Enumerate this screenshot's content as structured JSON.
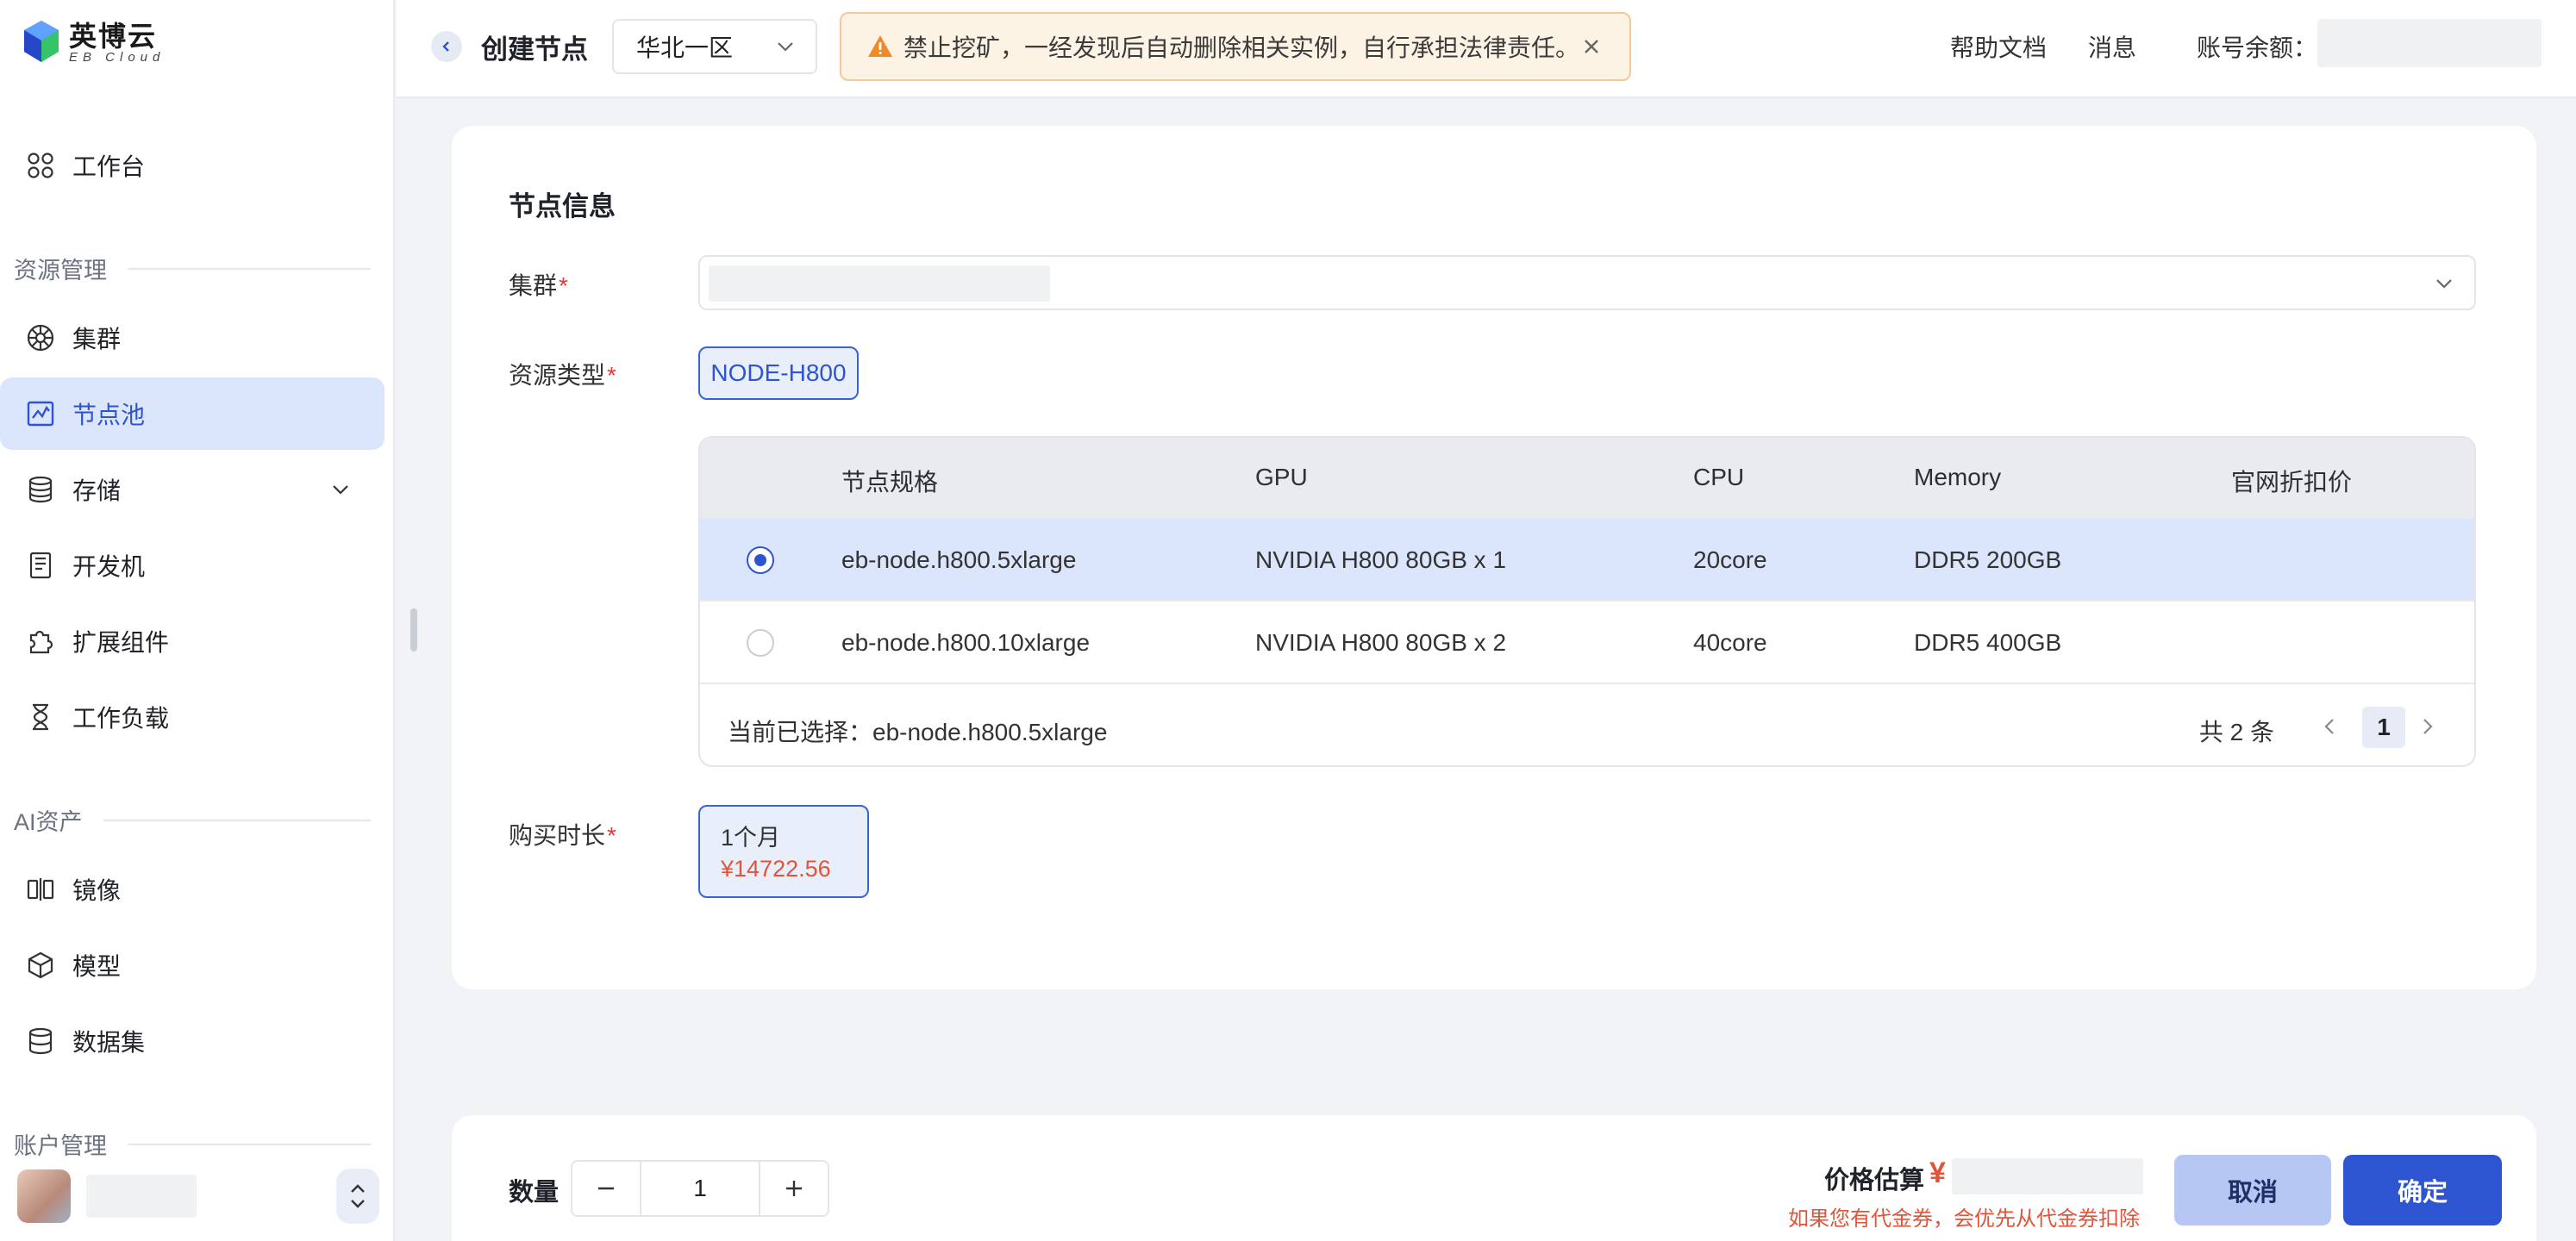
{
  "brand": {
    "name_cn": "英博云",
    "name_en": "EB Cloud"
  },
  "sidebar": {
    "workbench": "工作台",
    "sections": {
      "resource": "资源管理",
      "ai_assets": "AI资产",
      "account": "账户管理"
    },
    "items": [
      {
        "label": "集群",
        "icon": "cluster-icon"
      },
      {
        "label": "节点池",
        "icon": "node-pool-icon",
        "active": true
      },
      {
        "label": "存储",
        "icon": "storage-icon",
        "expandable": true
      },
      {
        "label": "开发机",
        "icon": "dev-machine-icon"
      },
      {
        "label": "扩展组件",
        "icon": "puzzle-icon"
      },
      {
        "label": "工作负载",
        "icon": "hourglass-icon"
      },
      {
        "label": "镜像",
        "icon": "image-icon"
      },
      {
        "label": "模型",
        "icon": "cube-icon"
      },
      {
        "label": "数据集",
        "icon": "database-icon"
      }
    ]
  },
  "header": {
    "title": "创建节点",
    "region": "华北一区",
    "warning": "禁止挖矿，一经发现后自动删除相关实例，自行承担法律责任。",
    "help": "帮助文档",
    "messages": "消息",
    "balance_label": "账号余额："
  },
  "form": {
    "section_title": "节点信息",
    "cluster_label": "集群",
    "resource_type_label": "资源类型",
    "resource_type": "NODE-H800",
    "duration_label": "购买时长",
    "duration": {
      "period": "1个月",
      "price": "¥14722.56"
    }
  },
  "table": {
    "columns": [
      "节点规格",
      "GPU",
      "CPU",
      "Memory",
      "官网折扣价"
    ],
    "rows": [
      {
        "spec": "eb-node.h800.5xlarge",
        "gpu": "NVIDIA H800 80GB x 1",
        "cpu": "20core",
        "memory": "DDR5 200GB",
        "price": "",
        "selected": true
      },
      {
        "spec": "eb-node.h800.10xlarge",
        "gpu": "NVIDIA H800 80GB x 2",
        "cpu": "40core",
        "memory": "DDR5 400GB",
        "price": "",
        "selected": false
      }
    ],
    "selected_text": "当前已选择：eb-node.h800.5xlarge",
    "total_text": "共 2 条",
    "current_page": "1"
  },
  "footer": {
    "quantity_label": "数量",
    "quantity": "1",
    "price_label": "价格估算",
    "currency": "¥",
    "voucher_note": "如果您有代金券，会优先从代金券扣除",
    "cancel": "取消",
    "confirm": "确定"
  },
  "colors": {
    "accent": "#2e55d1",
    "active_bg": "#dbe5fb",
    "price": "#e0553a",
    "warning_bg": "#fdf3e5"
  }
}
